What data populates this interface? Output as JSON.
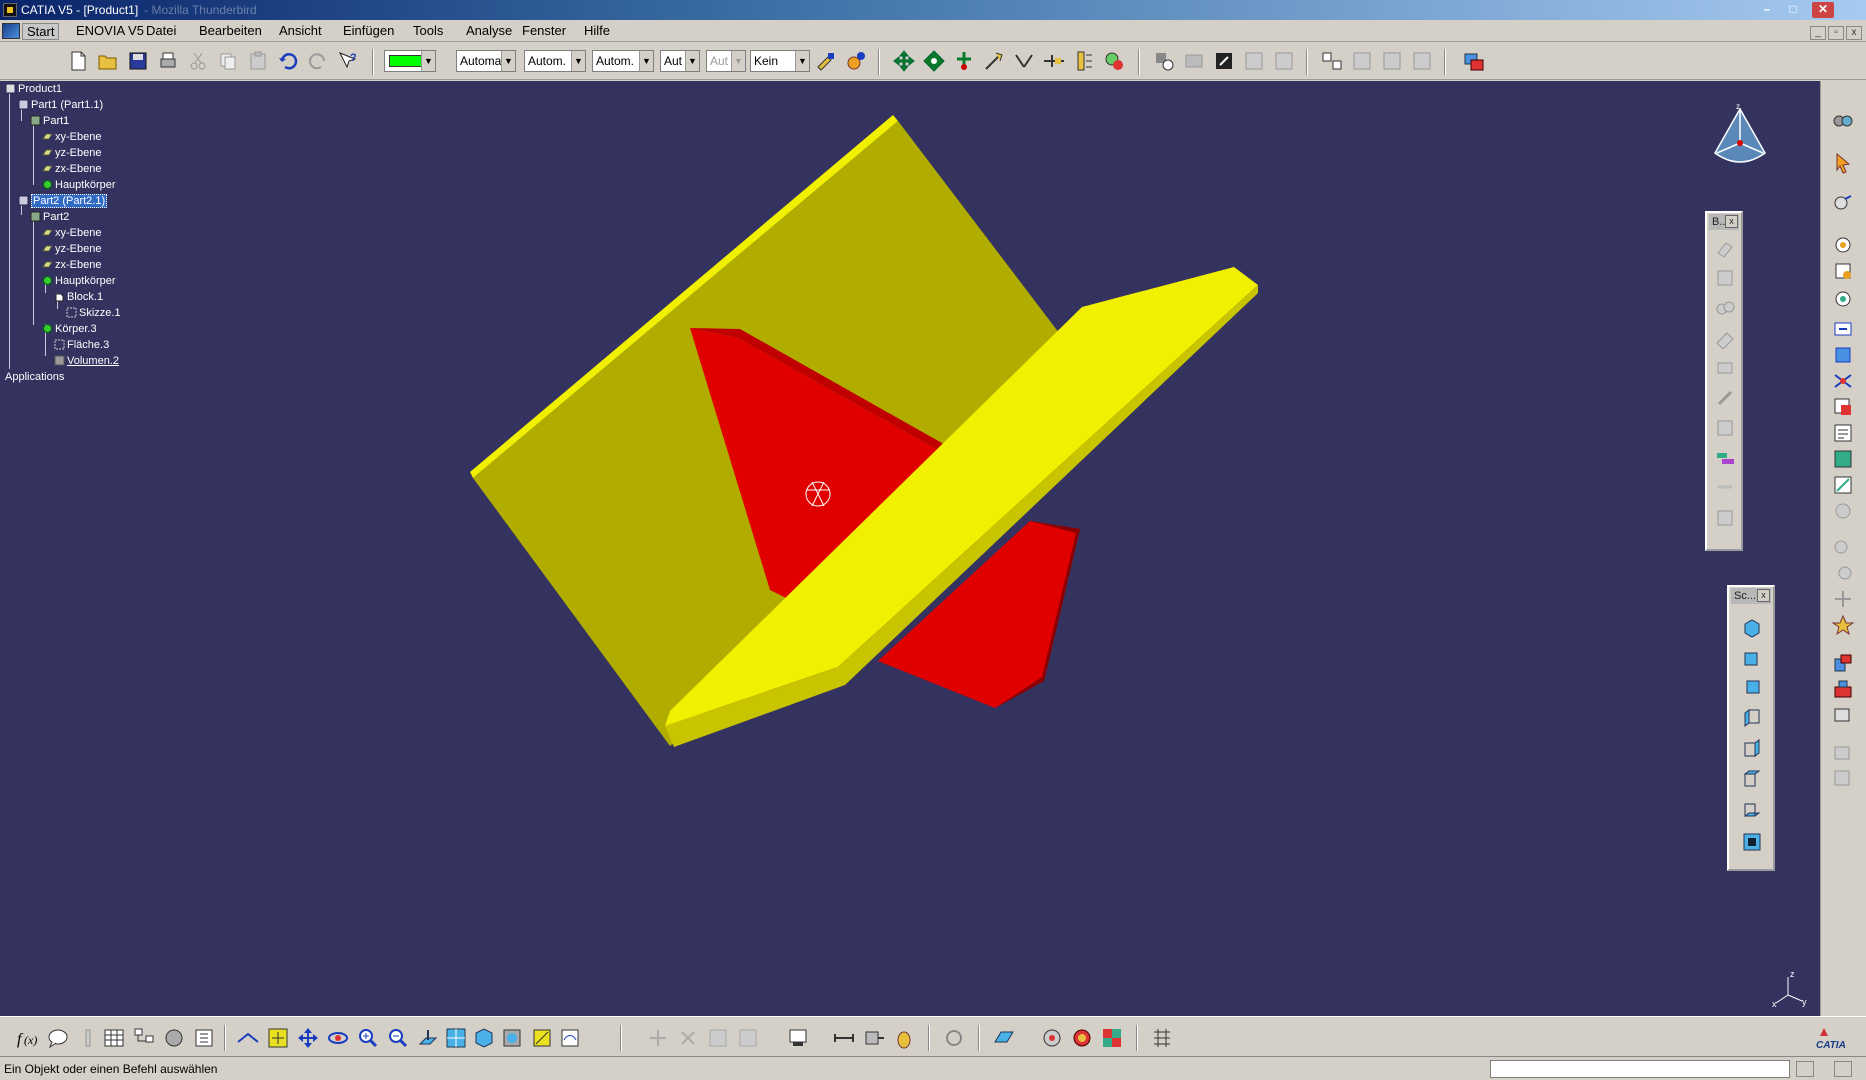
{
  "window": {
    "title": "CATIA V5 - [Product1]",
    "ghost_title": "- Mozilla Thunderbird"
  },
  "menu": {
    "items": [
      "Start",
      "ENOVIA V5",
      "Datei",
      "Bearbeiten",
      "Ansicht",
      "Einfügen",
      "Tools",
      "Analyse",
      "Fenster",
      "Hilfe"
    ]
  },
  "toolbar": {
    "color_value": "",
    "color_swatch": "#00ff00",
    "dropdowns": [
      "Automa",
      "Autom.",
      "Autom.",
      "Aut",
      "Aut",
      "Kein"
    ]
  },
  "tree": {
    "product": "Product1",
    "part1_instance": "Part1 (Part1.1)",
    "part1": "Part1",
    "xy1": "xy-Ebene",
    "yz1": "yz-Ebene",
    "zx1": "zx-Ebene",
    "body1": "Hauptkörper",
    "part2_instance": "Part2 (Part2.1)",
    "part2": "Part2",
    "xy2": "xy-Ebene",
    "yz2": "yz-Ebene",
    "zx2": "zx-Ebene",
    "body2": "Hauptkörper",
    "block": "Block.1",
    "sketch": "Skizze.1",
    "body3": "Körper.3",
    "surface": "Fläche.3",
    "volume": "Volumen.2",
    "applications": "Applications"
  },
  "floating": {
    "tb1_title": "B...",
    "tb2_title": "Sc..."
  },
  "status": {
    "text": "Ein Objekt oder einen Befehl auswählen",
    "input_value": ""
  },
  "colors": {
    "viewport_bg": "#34325f",
    "yellow_plate": "#b0ac00",
    "yellow_edge": "#f0f000",
    "red_plate": "#e00000",
    "red_edge": "#8a0000"
  }
}
